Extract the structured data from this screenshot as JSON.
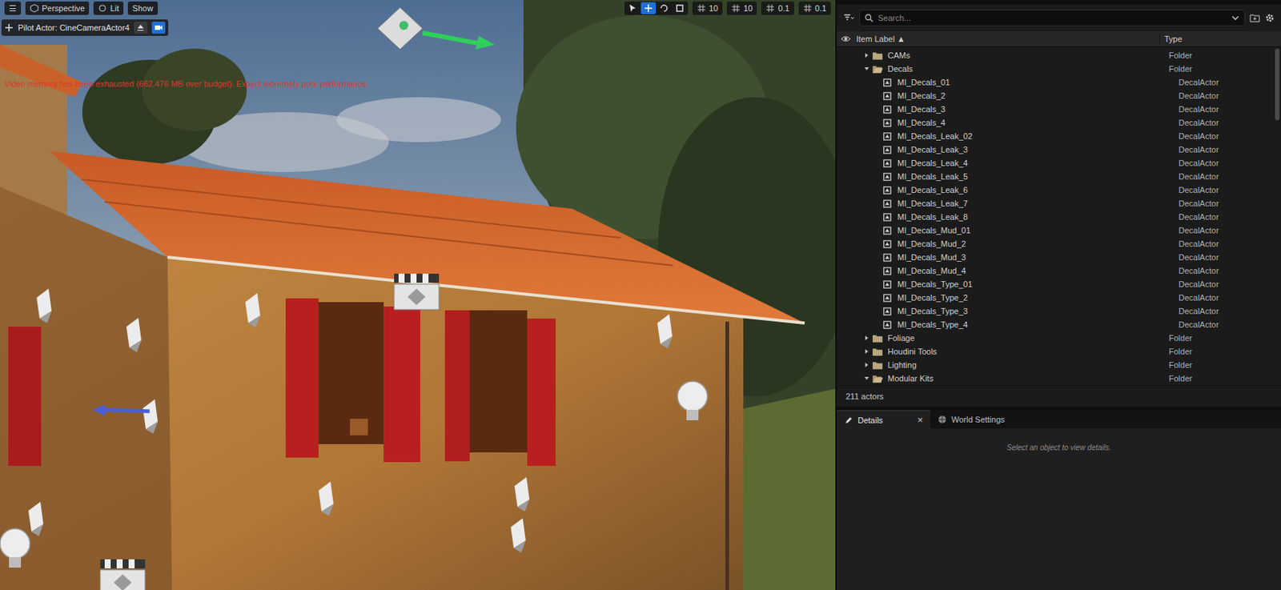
{
  "viewport": {
    "toolbar": {
      "menu_icon": "☰",
      "view_mode": "Perspective",
      "lighting": "Lit",
      "show": "Show",
      "transform_tools": [
        {
          "kind": "select",
          "selected": false
        },
        {
          "kind": "move",
          "selected": true
        },
        {
          "kind": "rotate",
          "selected": false
        },
        {
          "kind": "scale",
          "selected": false
        }
      ],
      "snaps": [
        "10",
        "10",
        "0.1",
        "0.1"
      ]
    },
    "pilot": {
      "label": "Pilot Actor: CineCameraActor4"
    },
    "warning": "Video memory has been exhausted (662.476 MB over budget). Expect extremely poor performance."
  },
  "outliner": {
    "search": {
      "placeholder": "Search..."
    },
    "columns": [
      {
        "label": "Item Label ▲"
      },
      {
        "label": "Type"
      }
    ],
    "rows": [
      {
        "label": "CAMs",
        "type": "Folder",
        "kind": "folder",
        "depth": 1,
        "expanded": false
      },
      {
        "label": "Decals",
        "type": "Folder",
        "kind": "folder",
        "depth": 1,
        "expanded": true
      },
      {
        "label": "MI_Decals_01",
        "type": "DecalActor",
        "kind": "actor",
        "depth": 2,
        "expanded": false
      },
      {
        "label": "MI_Decals_2",
        "type": "DecalActor",
        "kind": "actor",
        "depth": 2,
        "expanded": false
      },
      {
        "label": "MI_Decals_3",
        "type": "DecalActor",
        "kind": "actor",
        "depth": 2,
        "expanded": false
      },
      {
        "label": "MI_Decals_4",
        "type": "DecalActor",
        "kind": "actor",
        "depth": 2,
        "expanded": false
      },
      {
        "label": "MI_Decals_Leak_02",
        "type": "DecalActor",
        "kind": "actor",
        "depth": 2,
        "expanded": false
      },
      {
        "label": "MI_Decals_Leak_3",
        "type": "DecalActor",
        "kind": "actor",
        "depth": 2,
        "expanded": false
      },
      {
        "label": "MI_Decals_Leak_4",
        "type": "DecalActor",
        "kind": "actor",
        "depth": 2,
        "expanded": false
      },
      {
        "label": "MI_Decals_Leak_5",
        "type": "DecalActor",
        "kind": "actor",
        "depth": 2,
        "expanded": false
      },
      {
        "label": "MI_Decals_Leak_6",
        "type": "DecalActor",
        "kind": "actor",
        "depth": 2,
        "expanded": false
      },
      {
        "label": "MI_Decals_Leak_7",
        "type": "DecalActor",
        "kind": "actor",
        "depth": 2,
        "expanded": false
      },
      {
        "label": "MI_Decals_Leak_8",
        "type": "DecalActor",
        "kind": "actor",
        "depth": 2,
        "expanded": false
      },
      {
        "label": "MI_Decals_Mud_01",
        "type": "DecalActor",
        "kind": "actor",
        "depth": 2,
        "expanded": false
      },
      {
        "label": "MI_Decals_Mud_2",
        "type": "DecalActor",
        "kind": "actor",
        "depth": 2,
        "expanded": false
      },
      {
        "label": "MI_Decals_Mud_3",
        "type": "DecalActor",
        "kind": "actor",
        "depth": 2,
        "expanded": false
      },
      {
        "label": "MI_Decals_Mud_4",
        "type": "DecalActor",
        "kind": "actor",
        "depth": 2,
        "expanded": false
      },
      {
        "label": "MI_Decals_Type_01",
        "type": "DecalActor",
        "kind": "actor",
        "depth": 2,
        "expanded": false
      },
      {
        "label": "MI_Decals_Type_2",
        "type": "DecalActor",
        "kind": "actor",
        "depth": 2,
        "expanded": false
      },
      {
        "label": "MI_Decals_Type_3",
        "type": "DecalActor",
        "kind": "actor",
        "depth": 2,
        "expanded": false
      },
      {
        "label": "MI_Decals_Type_4",
        "type": "DecalActor",
        "kind": "actor",
        "depth": 2,
        "expanded": false
      },
      {
        "label": "Foliage",
        "type": "Folder",
        "kind": "folder",
        "depth": 1,
        "expanded": false
      },
      {
        "label": "Houdini Tools",
        "type": "Folder",
        "kind": "folder",
        "depth": 1,
        "expanded": false
      },
      {
        "label": "Lighting",
        "type": "Folder",
        "kind": "folder",
        "depth": 1,
        "expanded": false
      },
      {
        "label": "Modular Kits",
        "type": "Folder",
        "kind": "folder",
        "depth": 1,
        "expanded": true
      }
    ],
    "count": "211 actors"
  },
  "details": {
    "tabs": [
      {
        "label": "Details",
        "selected": true,
        "close": "×"
      },
      {
        "label": "World Settings",
        "selected": false,
        "close": ""
      }
    ],
    "empty_message": "Select an object to view details."
  }
}
